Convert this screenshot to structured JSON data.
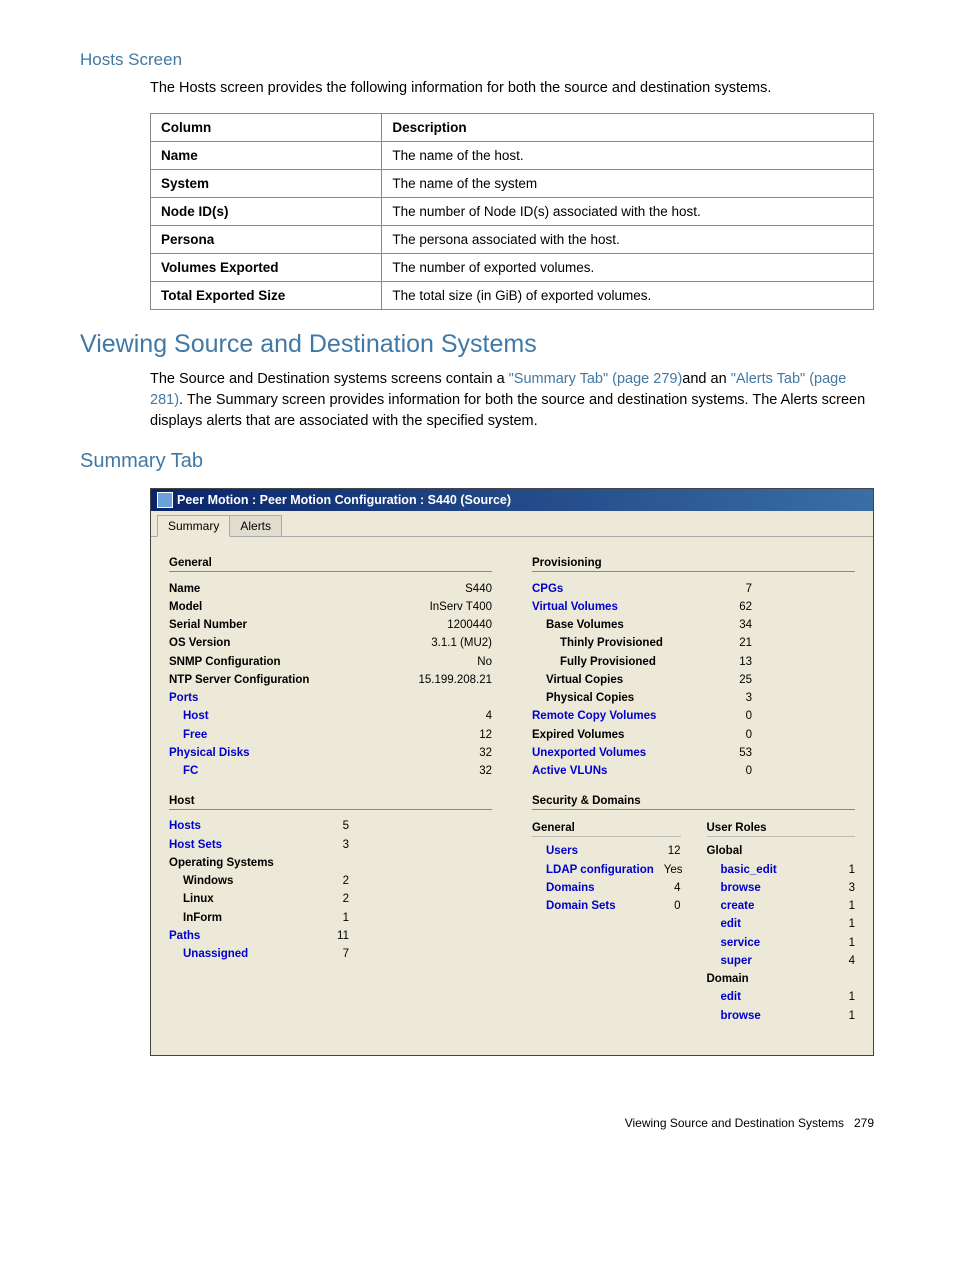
{
  "hosts_screen": {
    "heading": "Hosts Screen",
    "intro": "The Hosts screen provides the following information for both the source and destination systems.",
    "table": {
      "headers": {
        "col": "Column",
        "desc": "Description"
      },
      "rows": [
        {
          "col": "Name",
          "desc": "The name of the host."
        },
        {
          "col": "System",
          "desc": "The name of the system"
        },
        {
          "col": "Node ID(s)",
          "desc": "The number of Node ID(s) associated with the host."
        },
        {
          "col": "Persona",
          "desc": "The persona associated with the host."
        },
        {
          "col": "Volumes Exported",
          "desc": "The number of exported volumes."
        },
        {
          "col": "Total Exported Size",
          "desc": "The total size (in GiB) of exported volumes."
        }
      ]
    }
  },
  "main": {
    "heading": "Viewing Source and Destination Systems",
    "para_parts": {
      "p1": "The Source and Destination systems screens contain a ",
      "link1": "\"Summary Tab\" (page 279)",
      "p2": "and an ",
      "link2": "\"Alerts Tab\" (page 281)",
      "p3": ". The Summary screen provides information for both the source and destination systems. The Alerts screen displays alerts that are associated with the specified system."
    }
  },
  "summary_tab_heading": "Summary Tab",
  "window": {
    "title": "Peer Motion : Peer Motion Configuration : S440 (Source)",
    "tabs": {
      "summary": "Summary",
      "alerts": "Alerts"
    },
    "general": {
      "heading": "General",
      "name_lbl": "Name",
      "name_val": "S440",
      "model_lbl": "Model",
      "model_val": "InServ T400",
      "serial_lbl": "Serial Number",
      "serial_val": "1200440",
      "os_lbl": "OS Version",
      "os_val": "3.1.1 (MU2)",
      "snmp_lbl": "SNMP Configuration",
      "snmp_val": "No",
      "ntp_lbl": "NTP Server Configuration",
      "ntp_val": "15.199.208.21",
      "ports_lbl": "Ports",
      "ports_host_lbl": "Host",
      "ports_host_val": "4",
      "ports_free_lbl": "Free",
      "ports_free_val": "12",
      "pdisks_lbl": "Physical Disks",
      "pdisks_val": "32",
      "fc_lbl": "FC",
      "fc_val": "32"
    },
    "host": {
      "heading": "Host",
      "hosts_lbl": "Hosts",
      "hosts_val": "5",
      "hostsets_lbl": "Host Sets",
      "hostsets_val": "3",
      "os_lbl": "Operating Systems",
      "win_lbl": "Windows",
      "win_val": "2",
      "lin_lbl": "Linux",
      "lin_val": "2",
      "inf_lbl": "InForm",
      "inf_val": "1",
      "paths_lbl": "Paths",
      "paths_val": "11",
      "unass_lbl": "Unassigned",
      "unass_val": "7"
    },
    "prov": {
      "heading": "Provisioning",
      "cpgs_lbl": "CPGs",
      "cpgs_val": "7",
      "vv_lbl": "Virtual Volumes",
      "vv_val": "62",
      "base_lbl": "Base Volumes",
      "base_val": "34",
      "thin_lbl": "Thinly Provisioned",
      "thin_val": "21",
      "full_lbl": "Fully Provisioned",
      "full_val": "13",
      "vcop_lbl": "Virtual Copies",
      "vcop_val": "25",
      "pcop_lbl": "Physical Copies",
      "pcop_val": "3",
      "rcv_lbl": "Remote Copy Volumes",
      "rcv_val": "0",
      "exp_lbl": "Expired Volumes",
      "exp_val": "0",
      "unexp_lbl": "Unexported Volumes",
      "unexp_val": "53",
      "avlun_lbl": "Active VLUNs",
      "avlun_val": "0"
    },
    "sec": {
      "heading": "Security & Domains",
      "general_heading": "General",
      "users_lbl": "Users",
      "users_val": "12",
      "ldap_lbl": "LDAP configuration",
      "ldap_val": "Yes",
      "dom_lbl": "Domains",
      "dom_val": "4",
      "domsets_lbl": "Domain Sets",
      "domsets_val": "0",
      "roles_heading": "User Roles",
      "global_lbl": "Global",
      "basic_edit_lbl": "basic_edit",
      "basic_edit_val": "1",
      "browse_lbl": "browse",
      "browse_val": "3",
      "create_lbl": "create",
      "create_val": "1",
      "edit_lbl": "edit",
      "edit_val": "1",
      "service_lbl": "service",
      "service_val": "1",
      "super_lbl": "super",
      "super_val": "4",
      "domain_lbl": "Domain",
      "d_edit_lbl": "edit",
      "d_edit_val": "1",
      "d_browse_lbl": "browse",
      "d_browse_val": "1"
    }
  },
  "footer": {
    "text": "Viewing Source and Destination Systems",
    "page": "279"
  }
}
